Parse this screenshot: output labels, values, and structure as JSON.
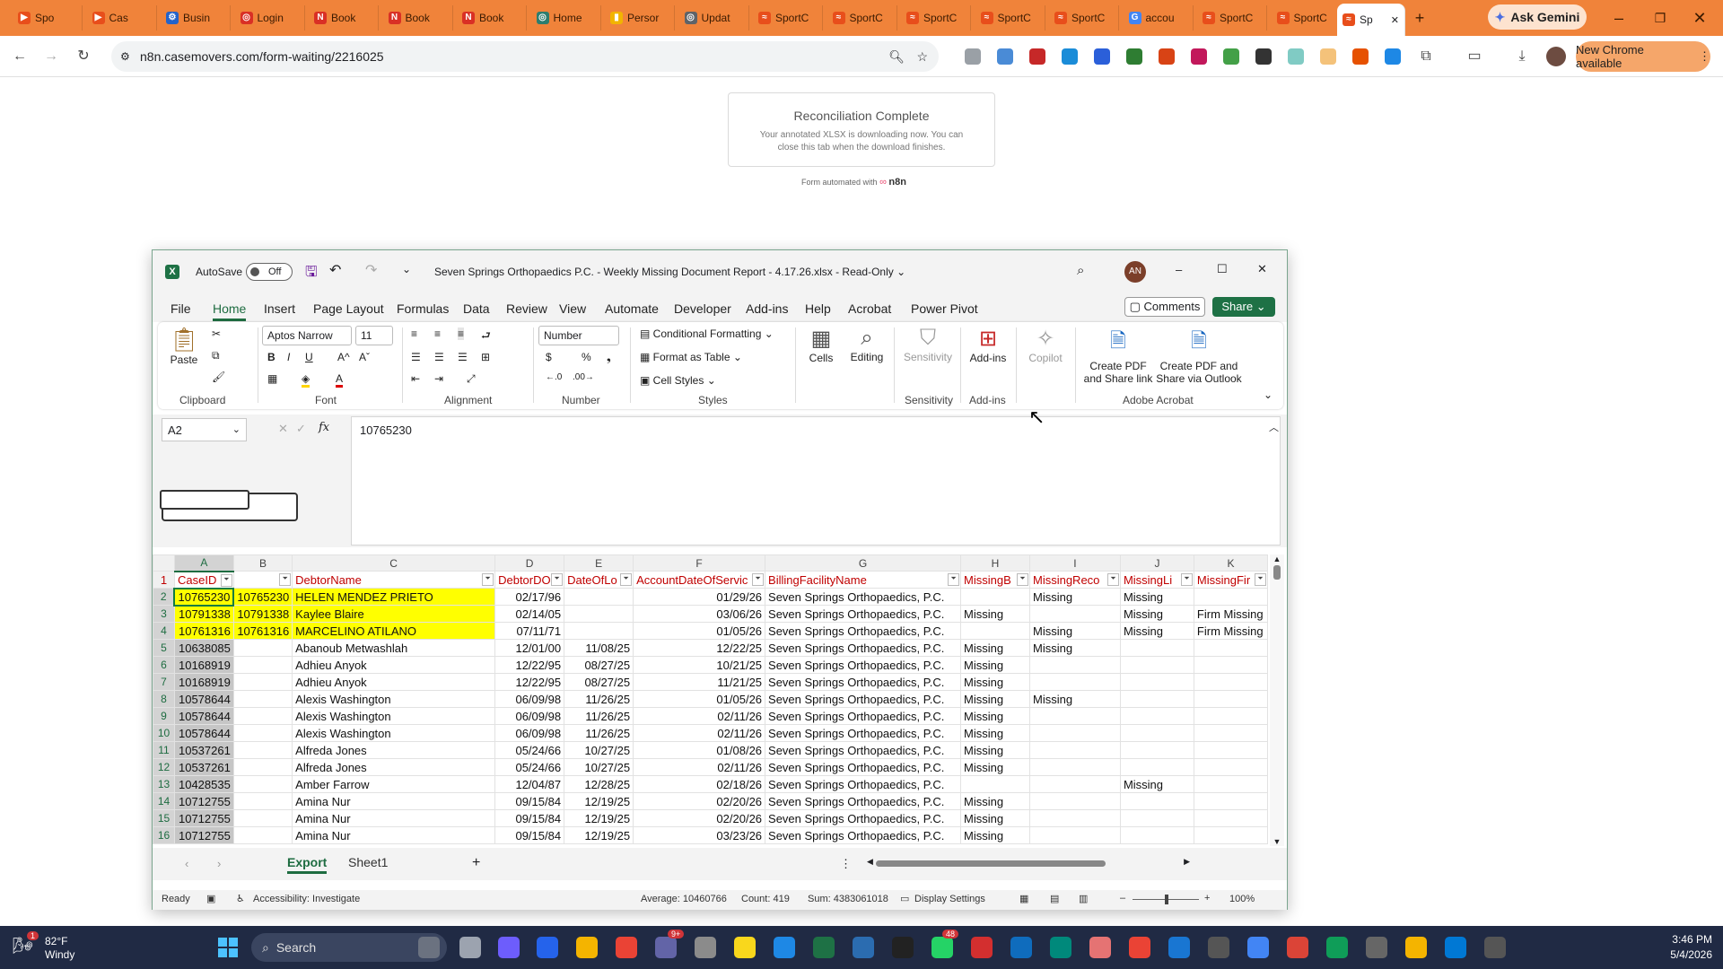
{
  "browser": {
    "tabs": [
      {
        "label": "Spo",
        "color": "#e84e1b",
        "glyph": "▶"
      },
      {
        "label": "Cas",
        "color": "#e84e1b",
        "glyph": "▶"
      },
      {
        "label": "Busin",
        "color": "#2563c9",
        "glyph": "⚙"
      },
      {
        "label": "Login",
        "color": "#d93025",
        "glyph": "◎"
      },
      {
        "label": "Book",
        "color": "#d93025",
        "glyph": "N"
      },
      {
        "label": "Book",
        "color": "#d93025",
        "glyph": "N"
      },
      {
        "label": "Book",
        "color": "#d93025",
        "glyph": "N"
      },
      {
        "label": "Home",
        "color": "#2d7d6e",
        "glyph": "◎"
      },
      {
        "label": "Persor",
        "color": "#f2b400",
        "glyph": "▮"
      },
      {
        "label": "Updat",
        "color": "#5f6368",
        "glyph": "◎"
      },
      {
        "label": "SportC",
        "color": "#e84e1b",
        "glyph": "≈"
      },
      {
        "label": "SportC",
        "color": "#e84e1b",
        "glyph": "≈"
      },
      {
        "label": "SportC",
        "color": "#e84e1b",
        "glyph": "≈"
      },
      {
        "label": "SportC",
        "color": "#e84e1b",
        "glyph": "≈"
      },
      {
        "label": "SportC",
        "color": "#e84e1b",
        "glyph": "≈"
      },
      {
        "label": "accou",
        "color": "#4285f4",
        "glyph": "G"
      },
      {
        "label": "SportC",
        "color": "#e84e1b",
        "glyph": "≈"
      },
      {
        "label": "SportC",
        "color": "#e84e1b",
        "glyph": "≈"
      }
    ],
    "active_tab": {
      "label": "Sp",
      "close": "✕"
    },
    "new_tab": "+",
    "ask_gemini": "Ask Gemini",
    "url": "n8n.casemovers.com/form-waiting/2216025",
    "new_chrome": "New Chrome available"
  },
  "page": {
    "card_title": "Reconciliation Complete",
    "card_body": "Your annotated XLSX is downloading now. You can close this tab when the download finishes.",
    "footer_prefix": "Form automated with",
    "footer_brand": "n8n"
  },
  "excel": {
    "autosave_label": "AutoSave",
    "autosave_state": "Off",
    "title": "Seven Springs Orthopaedics P.C. - Weekly Missing Document Report - 4.17.26.xlsx  -  Read-Only ⌄",
    "avatar": "AN",
    "menu": [
      "File",
      "Home",
      "Insert",
      "Page Layout",
      "Formulas",
      "Data",
      "Review",
      "View",
      "Automate",
      "Developer",
      "Add-ins",
      "Help",
      "Acrobat",
      "Power Pivot"
    ],
    "comments": "Comments",
    "share": "Share",
    "ribbon": {
      "paste": "Paste",
      "clipboard": "Clipboard",
      "font_name": "Aptos Narrow",
      "font_size": "11",
      "font": "Font",
      "alignment": "Alignment",
      "number_format": "Number",
      "number": "Number",
      "cond_format": "Conditional Formatting ⌄",
      "format_table": "Format as Table ⌄",
      "cell_styles": "Cell Styles ⌄",
      "styles": "Styles",
      "cells": "Cells",
      "editing": "Editing",
      "sensitivity_btn": "Sensitivity",
      "sensitivity": "Sensitivity",
      "addins_btn": "Add-ins",
      "addins": "Add-ins",
      "copilot": "Copilot",
      "pdf_link": "Create PDF and Share link",
      "pdf_outlook": "Create PDF and Share via Outlook",
      "adobe": "Adobe Acrobat"
    },
    "name_box": "A2",
    "formula_value": "10765230",
    "columns": [
      "A",
      "B",
      "C",
      "D",
      "E",
      "F",
      "G",
      "H",
      "I",
      "J",
      "K"
    ],
    "headers": [
      "CaseID",
      "",
      "DebtorName",
      "DebtorDO",
      "DateOfLo",
      "AccountDateOfServic",
      "BillingFacilityName",
      "MissingB",
      "MissingReco",
      "MissingLi",
      "MissingFir"
    ],
    "rows": [
      [
        "2",
        "10765230",
        "10765230",
        "HELEN MENDEZ PRIETO",
        "02/17/96",
        "",
        "01/29/26",
        "Seven Springs Orthopaedics, P.C.",
        "",
        "Missing",
        "Missing",
        ""
      ],
      [
        "3",
        "10791338",
        "10791338",
        "Kaylee Blaire",
        "02/14/05",
        "",
        "03/06/26",
        "Seven Springs Orthopaedics, P.C.",
        "Missing",
        "",
        "Missing",
        "Firm Missing"
      ],
      [
        "4",
        "10761316",
        "10761316",
        "MARCELINO ATILANO",
        "07/11/71",
        "",
        "01/05/26",
        "Seven Springs Orthopaedics, P.C.",
        "",
        "Missing",
        "Missing",
        "Firm Missing"
      ],
      [
        "5",
        "10638085",
        "",
        "Abanoub Metwashlah",
        "12/01/00",
        "11/08/25",
        "12/22/25",
        "Seven Springs Orthopaedics, P.C.",
        "Missing",
        "Missing",
        "",
        ""
      ],
      [
        "6",
        "10168919",
        "",
        "Adhieu Anyok",
        "12/22/95",
        "08/27/25",
        "10/21/25",
        "Seven Springs Orthopaedics, P.C.",
        "Missing",
        "",
        "",
        ""
      ],
      [
        "7",
        "10168919",
        "",
        "Adhieu Anyok",
        "12/22/95",
        "08/27/25",
        "11/21/25",
        "Seven Springs Orthopaedics, P.C.",
        "Missing",
        "",
        "",
        ""
      ],
      [
        "8",
        "10578644",
        "",
        "Alexis Washington",
        "06/09/98",
        "11/26/25",
        "01/05/26",
        "Seven Springs Orthopaedics, P.C.",
        "Missing",
        "Missing",
        "",
        ""
      ],
      [
        "9",
        "10578644",
        "",
        "Alexis Washington",
        "06/09/98",
        "11/26/25",
        "02/11/26",
        "Seven Springs Orthopaedics, P.C.",
        "Missing",
        "",
        "",
        ""
      ],
      [
        "10",
        "10578644",
        "",
        "Alexis Washington",
        "06/09/98",
        "11/26/25",
        "02/11/26",
        "Seven Springs Orthopaedics, P.C.",
        "Missing",
        "",
        "",
        ""
      ],
      [
        "11",
        "10537261",
        "",
        "Alfreda Jones",
        "05/24/66",
        "10/27/25",
        "01/08/26",
        "Seven Springs Orthopaedics, P.C.",
        "Missing",
        "",
        "",
        ""
      ],
      [
        "12",
        "10537261",
        "",
        "Alfreda Jones",
        "05/24/66",
        "10/27/25",
        "02/11/26",
        "Seven Springs Orthopaedics, P.C.",
        "Missing",
        "",
        "",
        ""
      ],
      [
        "13",
        "10428535",
        "",
        "Amber Farrow",
        "12/04/87",
        "12/28/25",
        "02/18/26",
        "Seven Springs Orthopaedics, P.C.",
        "",
        "",
        "Missing",
        ""
      ],
      [
        "14",
        "10712755",
        "",
        "Amina Nur",
        "09/15/84",
        "12/19/25",
        "02/20/26",
        "Seven Springs Orthopaedics, P.C.",
        "Missing",
        "",
        "",
        ""
      ],
      [
        "15",
        "10712755",
        "",
        "Amina Nur",
        "09/15/84",
        "12/19/25",
        "02/20/26",
        "Seven Springs Orthopaedics, P.C.",
        "Missing",
        "",
        "",
        ""
      ],
      [
        "16",
        "10712755",
        "",
        "Amina Nur",
        "09/15/84",
        "12/19/25",
        "03/23/26",
        "Seven Springs Orthopaedics, P.C.",
        "Missing",
        "",
        "",
        ""
      ]
    ],
    "sheets": [
      "Export",
      "Sheet1"
    ],
    "status": {
      "ready": "Ready",
      "accessibility": "Accessibility: Investigate",
      "average": "Average: 10460766",
      "count": "Count: 419",
      "sum": "Sum: 4383061018",
      "display": "Display Settings",
      "zoom": "100%"
    }
  },
  "taskbar": {
    "weather_temp": "82°F",
    "weather_desc": "Windy",
    "search": "Search",
    "time": "3:46 PM",
    "date": "5/4/2026",
    "badge_weather": "1",
    "badge_teams": "9+",
    "badge_whatsapp": "48"
  }
}
